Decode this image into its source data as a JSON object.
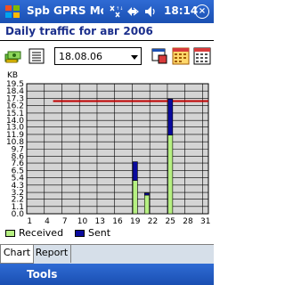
{
  "statusbar": {
    "app_title": "Spb GPRS Monit",
    "time": "18:14",
    "close_label": "×"
  },
  "header": {
    "title": "Daily traffic for авг 2006"
  },
  "toolbar": {
    "date_value": "18.08.06"
  },
  "chart_data": {
    "type": "bar",
    "ylabel": "KB",
    "ylim": [
      0,
      19.5
    ],
    "yticks": [
      "19.5",
      "18.4",
      "17.3",
      "16.2",
      "15.1",
      "14.0",
      "13.0",
      "11.9",
      "10.8",
      "9.7",
      "8.6",
      "7.6",
      "6.5",
      "5.4",
      "4.3",
      "3.2",
      "2.2",
      "1.1",
      "0.0"
    ],
    "xticks": [
      "1",
      "4",
      "7",
      "10",
      "13",
      "16",
      "19",
      "22",
      "25",
      "28",
      "31"
    ],
    "days": 31,
    "series": [
      {
        "name": "Received",
        "color": "#b6f082",
        "values": {
          "19": 5.0,
          "21": 2.8,
          "25": 11.8
        }
      },
      {
        "name": "Sent",
        "color": "#0a0a9e",
        "values": {
          "19": 2.8,
          "21": 0.3,
          "25": 5.4
        }
      }
    ],
    "limit_line": 16.9,
    "limit_color": "#c00000",
    "grid": true
  },
  "tabs": [
    {
      "label": "Chart",
      "active": true
    },
    {
      "label": "Report",
      "active": false
    }
  ],
  "menubar": {
    "tools_label": "Tools"
  }
}
